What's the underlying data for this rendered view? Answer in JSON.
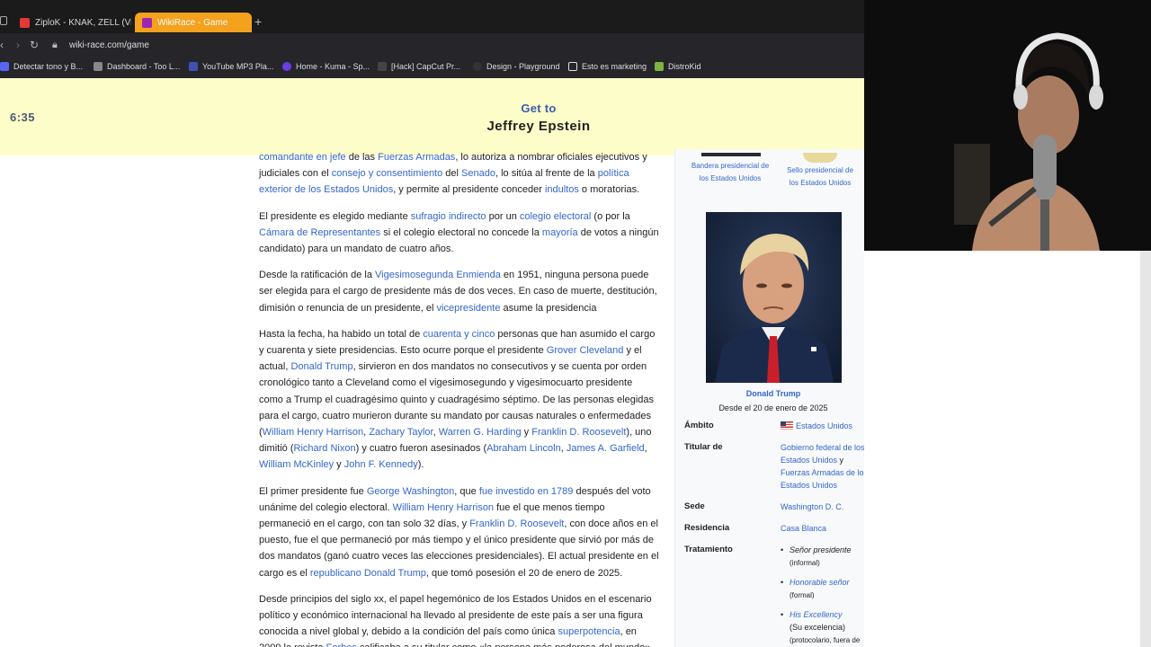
{
  "browser": {
    "tabs": [
      {
        "label": "ZiploK - KNAK, ZELL (Vide",
        "active": false
      },
      {
        "label": "WikiRace - Game",
        "active": true
      }
    ],
    "url": "wiki-race.com/game",
    "bookmarks": [
      {
        "label": "Detectar tono y B...",
        "color": "#5865f2"
      },
      {
        "label": "Dashboard - Too L...",
        "color": "#888888"
      },
      {
        "label": "YouTube MP3 Pla...",
        "color": "#3f51b5"
      },
      {
        "label": "Home - Kuma - Sp...",
        "color": "#6a3de8"
      },
      {
        "label": "[Hack] CapCut Pr...",
        "color": "#444444"
      },
      {
        "label": "Design - Playground",
        "color": "#333333"
      },
      {
        "label": "Esto es marketing",
        "color": "#dddddd"
      },
      {
        "label": "DistroKid",
        "color": "#7cb342"
      }
    ]
  },
  "game": {
    "timer": "6:35",
    "get_to": "Get to",
    "target": "Jeffrey Epstein"
  },
  "article": {
    "p0": [
      {
        "t": "comandante en jefe",
        "link": true
      },
      {
        "t": " de las ",
        "link": false
      },
      {
        "t": "Fuerzas Armadas",
        "link": true
      },
      {
        "t": ", lo autoriza a nombrar oficiales ejecutivos y judiciales con el ",
        "link": false
      },
      {
        "t": "consejo y consentimiento",
        "link": true
      },
      {
        "t": " del ",
        "link": false
      },
      {
        "t": "Senado",
        "link": true
      },
      {
        "t": ", lo sitúa al frente de la ",
        "link": false
      },
      {
        "t": "política exterior de los Estados Unidos",
        "link": true
      },
      {
        "t": ", y permite al presidente conceder ",
        "link": false
      },
      {
        "t": "indultos",
        "link": true
      },
      {
        "t": " o moratorias.",
        "link": false
      }
    ],
    "p1": [
      {
        "t": "El presidente es elegido mediante ",
        "link": false
      },
      {
        "t": "sufragio indirecto",
        "link": true
      },
      {
        "t": " por un ",
        "link": false
      },
      {
        "t": "colegio electoral",
        "link": true
      },
      {
        "t": " (o por la ",
        "link": false
      },
      {
        "t": "Cámara de Representantes",
        "link": true
      },
      {
        "t": " si el colegio electoral no concede la ",
        "link": false
      },
      {
        "t": "mayoría",
        "link": true
      },
      {
        "t": " de votos a ningún candidato) para un mandato de cuatro años.",
        "link": false
      }
    ],
    "p2": [
      {
        "t": "Desde la ratificación de la ",
        "link": false
      },
      {
        "t": "Vigesimosegunda Enmienda",
        "link": true
      },
      {
        "t": " en 1951, ninguna persona puede ser elegida para el cargo de presidente más de dos veces. En caso de muerte, destitución, dimisión o renuncia de un presidente, el ",
        "link": false
      },
      {
        "t": "vicepresidente",
        "link": true
      },
      {
        "t": " asume la presidencia",
        "link": false
      }
    ],
    "p3": [
      {
        "t": "Hasta la fecha, ha habido un total de ",
        "link": false
      },
      {
        "t": "cuarenta y cinco",
        "link": true
      },
      {
        "t": " personas que han asumido el cargo y cuarenta y siete presidencias. Esto ocurre porque el presidente ",
        "link": false
      },
      {
        "t": "Grover Cleveland",
        "link": true
      },
      {
        "t": " y el actual, ",
        "link": false
      },
      {
        "t": "Donald Trump",
        "link": true
      },
      {
        "t": ", sirvieron en dos mandatos no consecutivos y se cuenta por orden cronológico tanto a Cleveland como el vigesimosegundo y vigesimocuarto presidente como a Trump el cuadragésimo quinto y cuadragésimo séptimo. De las personas elegidas para el cargo, cuatro murieron durante su mandato por causas naturales o enfermedades (",
        "link": false
      },
      {
        "t": "William Henry Harrison",
        "link": true
      },
      {
        "t": ", ",
        "link": false
      },
      {
        "t": "Zachary Taylor",
        "link": true
      },
      {
        "t": ", ",
        "link": false
      },
      {
        "t": "Warren G. Harding",
        "link": true
      },
      {
        "t": " y ",
        "link": false
      },
      {
        "t": "Franklin D. Roosevelt",
        "link": true
      },
      {
        "t": "), uno dimitió (",
        "link": false
      },
      {
        "t": "Richard Nixon",
        "link": true
      },
      {
        "t": ") y cuatro fueron asesinados (",
        "link": false
      },
      {
        "t": "Abraham Lincoln",
        "link": true
      },
      {
        "t": ", ",
        "link": false
      },
      {
        "t": "James A. Garfield",
        "link": true
      },
      {
        "t": ", ",
        "link": false
      },
      {
        "t": "William McKinley",
        "link": true
      },
      {
        "t": " y ",
        "link": false
      },
      {
        "t": "John F. Kennedy",
        "link": true
      },
      {
        "t": ").",
        "link": false
      }
    ],
    "p4": [
      {
        "t": "El primer presidente fue ",
        "link": false
      },
      {
        "t": "George Washington",
        "link": true
      },
      {
        "t": ", que ",
        "link": false
      },
      {
        "t": "fue investido en 1789",
        "link": true
      },
      {
        "t": " después del voto unánime del colegio electoral. ",
        "link": false
      },
      {
        "t": "William Henry Harrison",
        "link": true
      },
      {
        "t": " fue el que menos tiempo permaneció en el cargo, con tan solo 32 días, y ",
        "link": false
      },
      {
        "t": "Franklin D. Roosevelt",
        "link": true
      },
      {
        "t": ", con doce años en el puesto, fue el que permaneció por más tiempo y el único presidente que sirvió por más de dos mandatos (ganó cuatro veces las elecciones presidenciales). El actual presidente en el cargo es el ",
        "link": false
      },
      {
        "t": "republicano",
        "link": true
      },
      {
        "t": " ",
        "link": false
      },
      {
        "t": "Donald Trump",
        "link": true
      },
      {
        "t": ", que tomó posesión el 20 de enero de 2025.",
        "link": false
      }
    ],
    "p5": [
      {
        "t": "Desde principios del siglo xx, el papel hegemónico de los Estados Unidos en el escenario político y económico internacional ha llevado al presidente de este país a ser una figura conocida a nivel global y, debido a la condición del país como única ",
        "link": false
      },
      {
        "t": "superpotencia",
        "link": true
      },
      {
        "t": ", en 2009 la revista ",
        "link": false
      },
      {
        "t": "Forbes",
        "link": true
      },
      {
        "t": " calificaba a su titular como «la persona más poderosa del mundo».",
        "link": false
      }
    ]
  },
  "infobox": {
    "flag_caption": "Bandera presidencial de los Estados Unidos",
    "seal_caption": "Sello presidencial de los Estados Unidos",
    "person_name": "Donald Trump",
    "since": "Desde el 20 de enero de 2025",
    "rows": {
      "ambito_label": "Ámbito",
      "ambito_value": "Estados Unidos",
      "titular_label": "Titular de",
      "titular_value_1": "Gobierno federal de los Estados Unidos",
      "titular_joiner": " y ",
      "titular_value_2": "Fuerzas Armadas de los Estados Unidos",
      "sede_label": "Sede",
      "sede_value": "Washington D. C.",
      "residencia_label": "Residencia",
      "residencia_value": "Casa Blanca",
      "tratamiento_label": "Tratamiento",
      "tratamiento": [
        {
          "title": "Señor presidente",
          "note": "(informal)"
        },
        {
          "title": "Honorable señor",
          "note": "(formal)"
        },
        {
          "title": "His Excellency",
          "note": "(Su excelencia)",
          "note2": "(protocolario, fuera de"
        }
      ]
    }
  }
}
